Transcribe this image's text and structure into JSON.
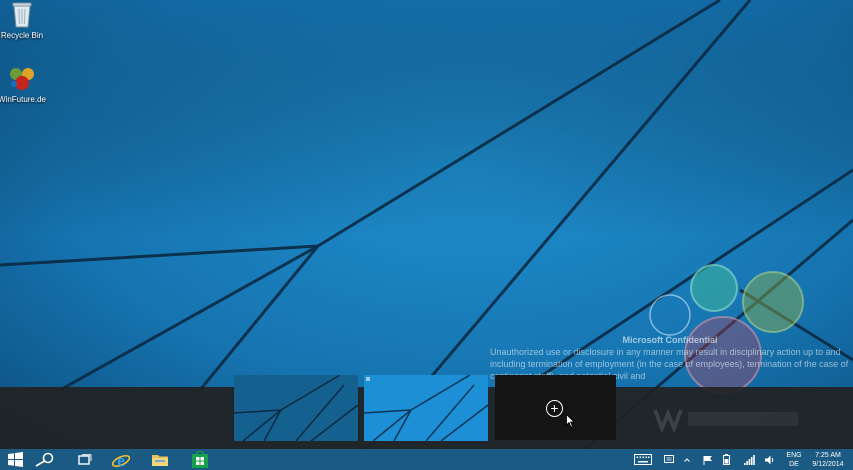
{
  "desktop": {
    "icons": [
      {
        "label": "Recycle Bin",
        "icon": "recycle-bin-icon"
      },
      {
        "label": "WinFuture.de",
        "icon": "winfuture-icon"
      }
    ]
  },
  "watermark": {
    "title": "Microsoft Confidential",
    "text": "Unauthorized use or disclosure in any manner may result in disciplinary action up to and including termination of employment (in the case of employees), termination of the case of contingent staff), and potential civil and"
  },
  "task_view": {
    "desktops": [
      {
        "name": "desktop-1-thumbnail"
      },
      {
        "name": "desktop-2-thumbnail"
      }
    ],
    "add_desktop_icon": "plus-circle-icon"
  },
  "taskbar": {
    "pinned": [
      "start-icon",
      "search-icon",
      "task-view-icon",
      "internet-explorer-icon",
      "file-explorer-icon",
      "store-icon"
    ],
    "tray": {
      "language_line1": "ENG",
      "language_line2": "DE",
      "time": "7:25 AM",
      "date": "9/12/2014"
    }
  },
  "colors": {
    "wallpaper": "#1a78b4",
    "taskbar": "#1b5a82",
    "task_view_bar": "#222222"
  }
}
